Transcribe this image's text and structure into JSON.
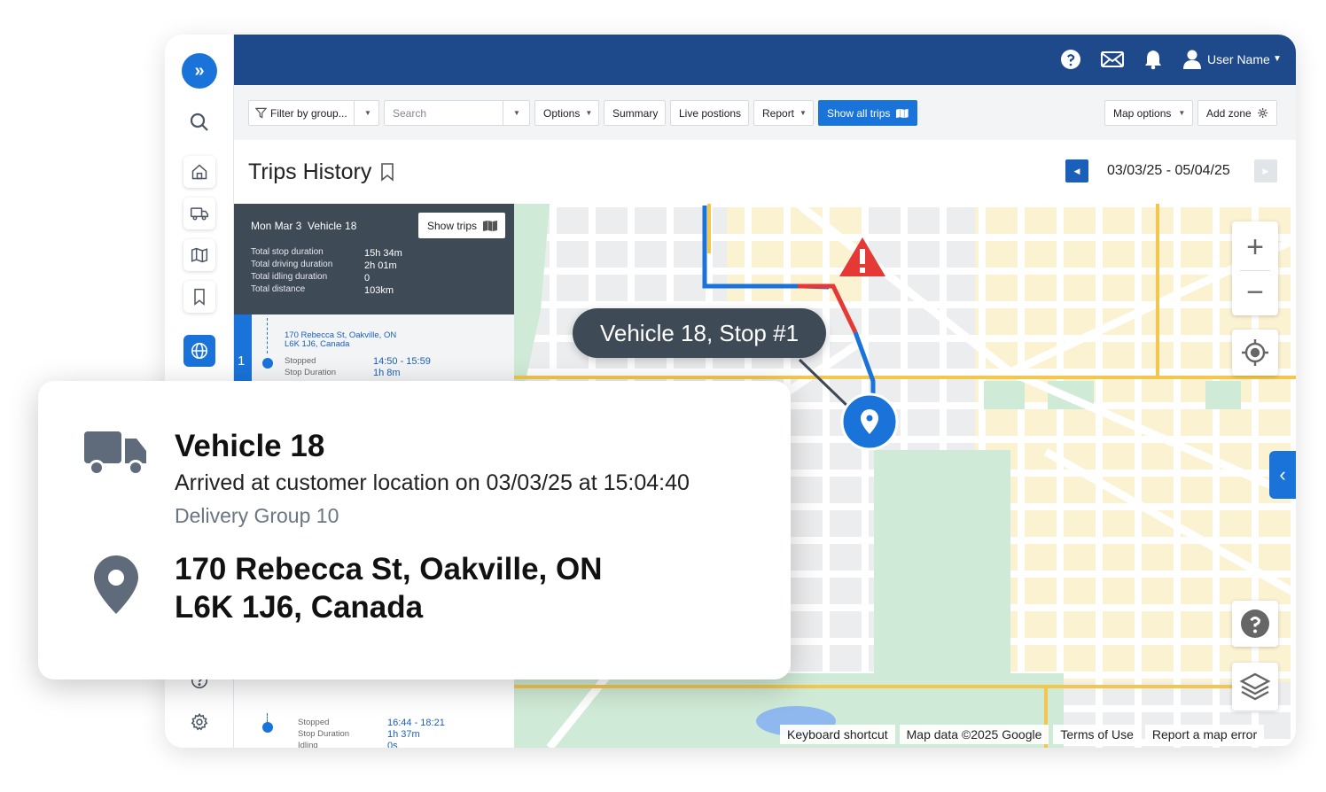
{
  "topbar": {
    "user_name": "User Name",
    "icons": [
      "help-circle-icon",
      "envelope-icon",
      "bell-icon",
      "user-icon"
    ]
  },
  "sidebar": {
    "icons": [
      "expand-icon",
      "search-icon",
      "home-icon",
      "truck-icon",
      "map-icon",
      "bookmark-icon",
      "globe-icon",
      "help-icon",
      "gear-icon"
    ]
  },
  "toolbar": {
    "filter_label": "Filter by group...",
    "search_placeholder": "Search",
    "options_label": "Options",
    "summary_label": "Summary",
    "live_label": "Live postions",
    "report_label": "Report",
    "show_all_label": "Show all trips",
    "map_options_label": "Map options",
    "add_zone_label": "Add zone"
  },
  "title": {
    "text": "Trips History",
    "date_range": "03/03/25 - 05/04/25"
  },
  "trip_summary": {
    "date": "Mon Mar 3",
    "vehicle": "Vehicle 18",
    "show_trips_label": "Show trips",
    "rows": [
      {
        "label": "Total stop duration",
        "value": "15h 34m"
      },
      {
        "label": "Total driving duration",
        "value": "2h 01m"
      },
      {
        "label": "Total idling duration",
        "value": "0"
      },
      {
        "label": "Total distance",
        "value": "103km"
      }
    ]
  },
  "stops": [
    {
      "number": "1",
      "address_line1": "170 Rebecca St, Oakville, ON",
      "address_line2": "L6K 1J6, Canada",
      "status": "Stopped",
      "time": "14:50 - 15:59",
      "duration_label": "Stop Duration",
      "duration": "1h 8m"
    },
    {
      "status": "Stopped",
      "time": "16:44 - 18:21",
      "duration_label": "Stop Duration",
      "duration": "1h 37m",
      "idling_label": "Idling",
      "idling": "0s"
    }
  ],
  "map": {
    "callout": "Vehicle 18, Stop #1",
    "attribution": [
      "Keyboard shortcut",
      "Map data ©2025 Google",
      "Terms of Use",
      "Report a map error"
    ],
    "route_color": "#1a73d9",
    "alert_color": "#e53935"
  },
  "info_card": {
    "vehicle": "Vehicle 18",
    "arrived": "Arrived at customer location on 03/03/25 at 15:04:40",
    "group": "Delivery Group 10",
    "address_line1": "170 Rebecca St, Oakville, ON",
    "address_line2": "L6K 1J6, Canada"
  }
}
